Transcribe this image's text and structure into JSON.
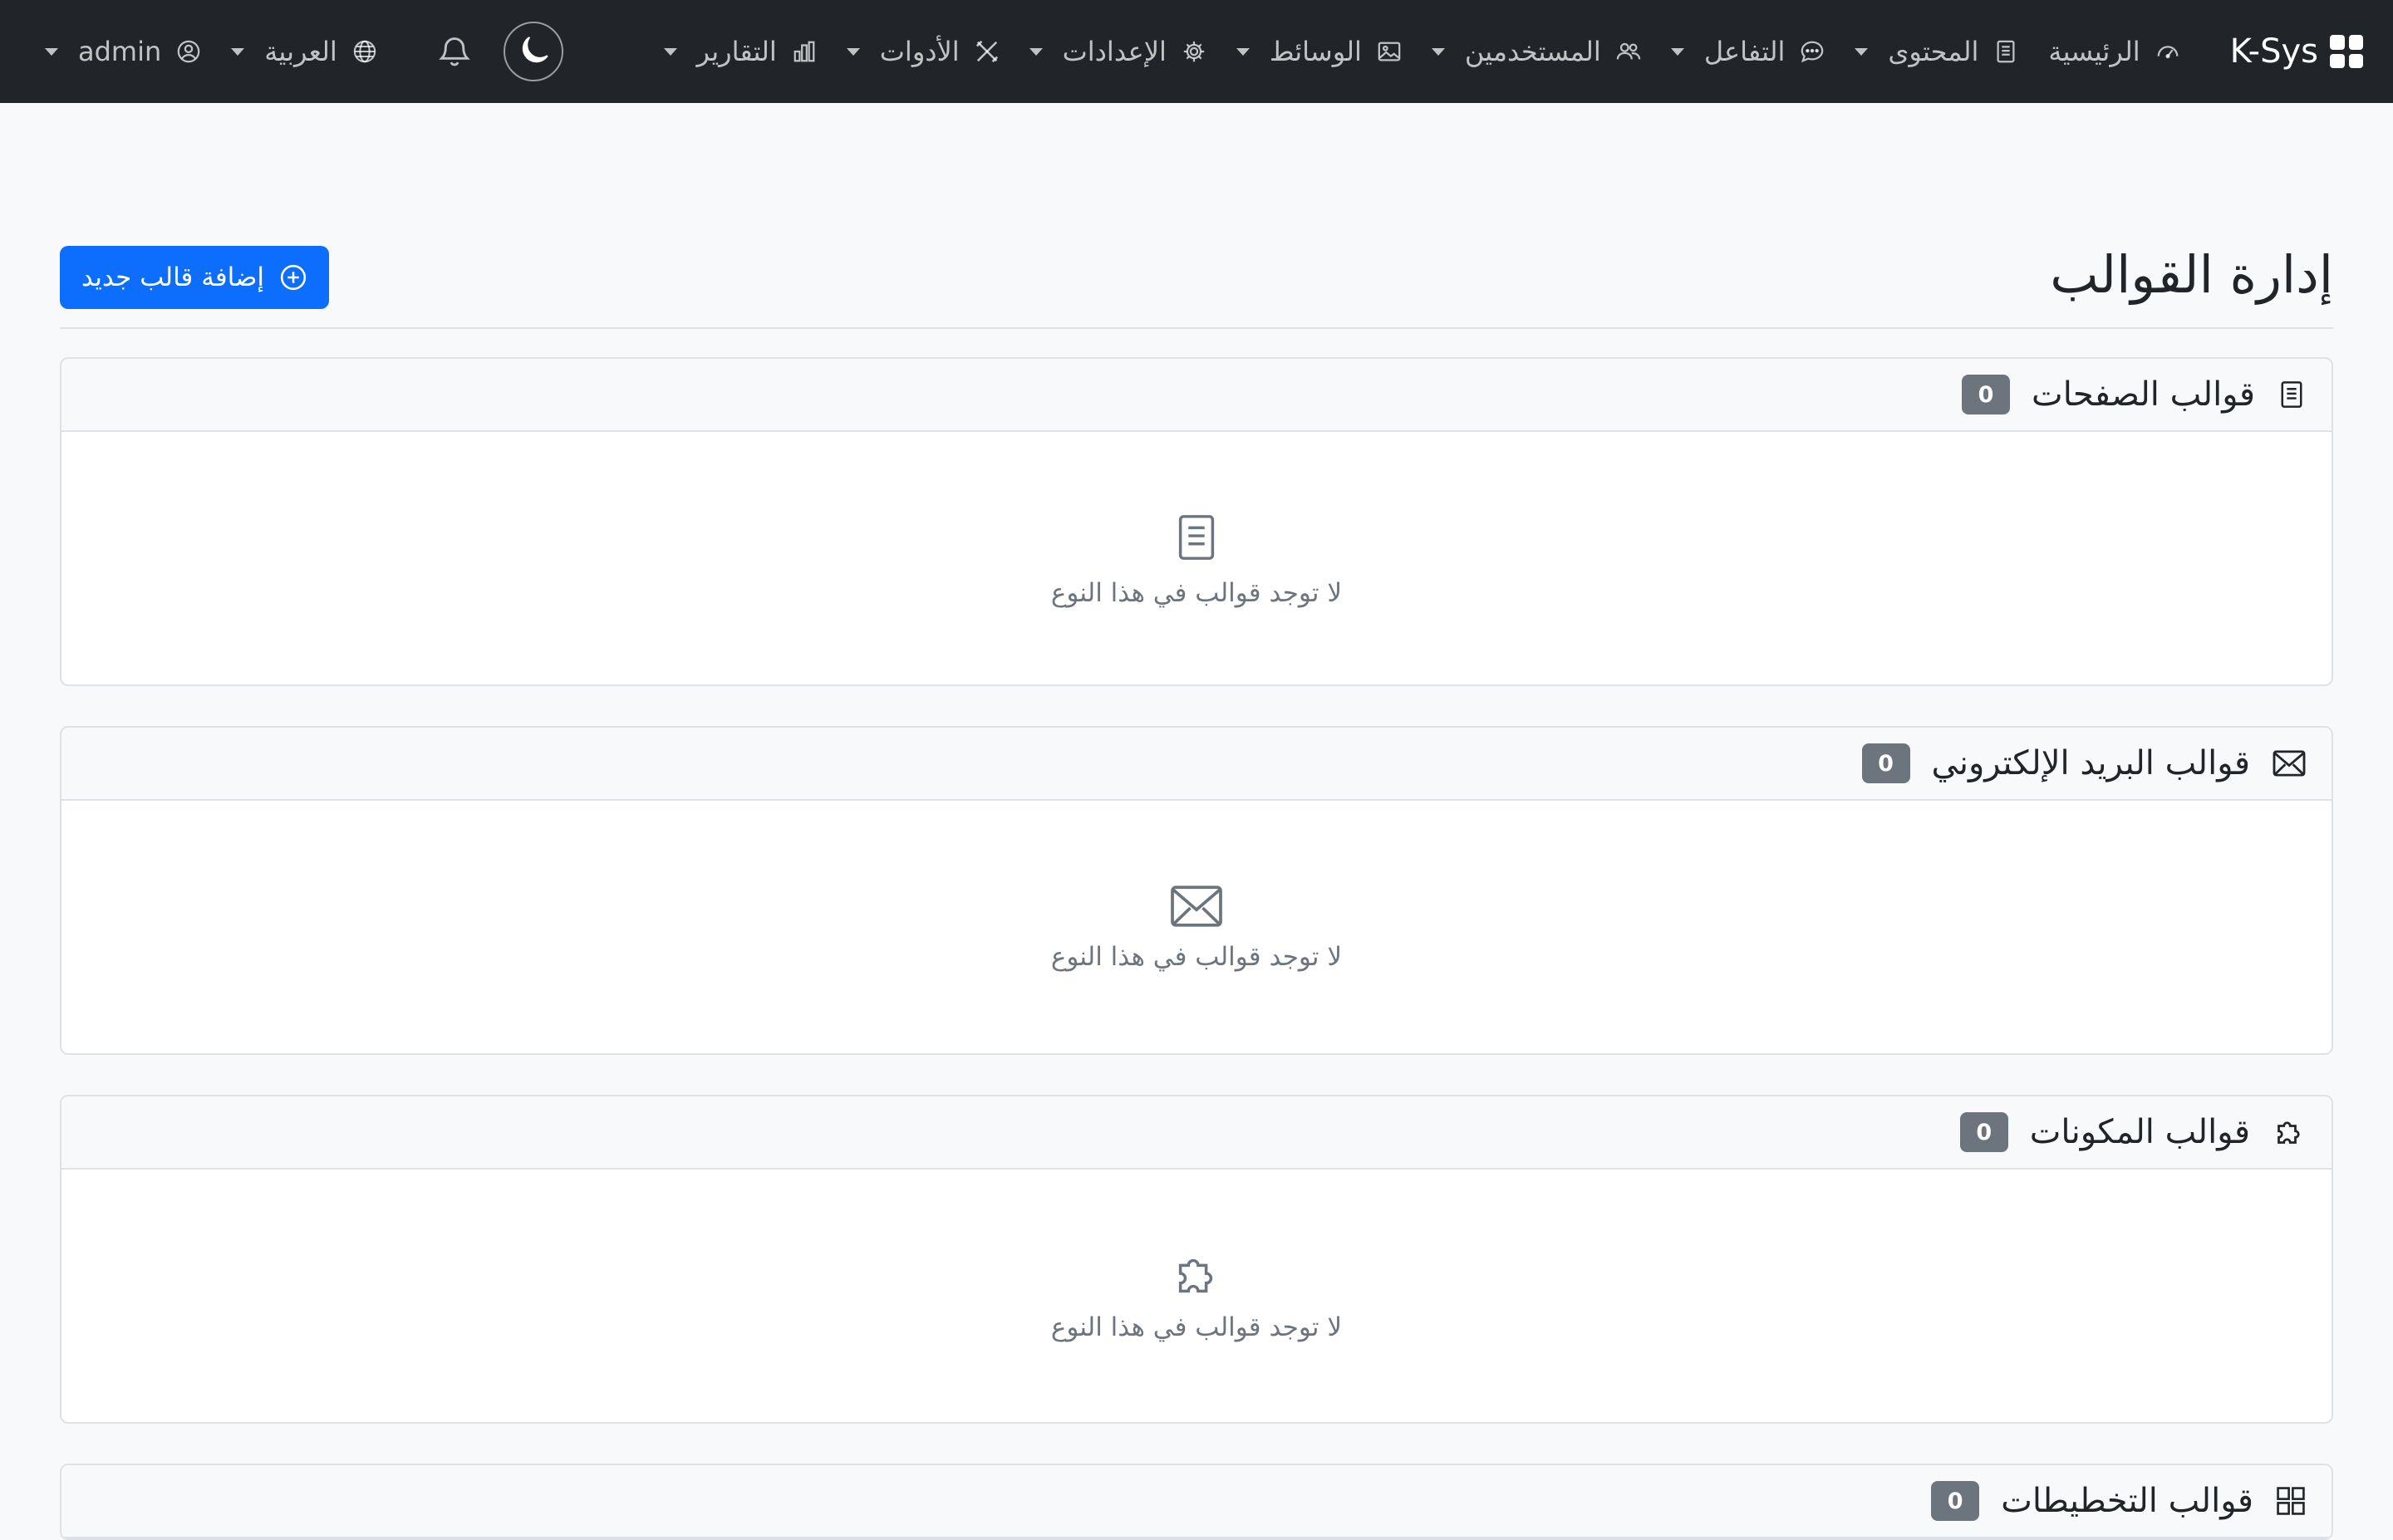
{
  "nav": {
    "brand": "K-Sys",
    "items": [
      {
        "label": "الرئيسية",
        "icon": "speedometer-icon",
        "dropdown": false
      },
      {
        "label": "المحتوى",
        "icon": "file-text-icon",
        "dropdown": true
      },
      {
        "label": "التفاعل",
        "icon": "chat-icon",
        "dropdown": true
      },
      {
        "label": "المستخدمين",
        "icon": "people-icon",
        "dropdown": true
      },
      {
        "label": "الوسائط",
        "icon": "image-icon",
        "dropdown": true
      },
      {
        "label": "الإعدادات",
        "icon": "gear-icon",
        "dropdown": true
      },
      {
        "label": "الأدوات",
        "icon": "tools-icon",
        "dropdown": true
      },
      {
        "label": "التقارير",
        "icon": "bar-chart-icon",
        "dropdown": true
      }
    ],
    "language": "العربية",
    "user": "admin"
  },
  "page": {
    "title": "إدارة القوالب",
    "add_button": "إضافة قالب جديد"
  },
  "sections": [
    {
      "title": "قوالب الصفحات",
      "count": "0",
      "icon": "file-text-icon",
      "empty_text": "لا توجد قوالب في هذا النوع"
    },
    {
      "title": "قوالب البريد الإلكتروني",
      "count": "0",
      "icon": "envelope-icon",
      "empty_text": "لا توجد قوالب في هذا النوع"
    },
    {
      "title": "قوالب المكونات",
      "count": "0",
      "icon": "puzzle-icon",
      "empty_text": "لا توجد قوالب في هذا النوع"
    },
    {
      "title": "قوالب التخطيطات",
      "count": "0",
      "icon": "grid-icon",
      "empty_text": ""
    }
  ],
  "colors": {
    "navbar": "#212529",
    "primary": "#0d6efd",
    "badge": "#6c757d",
    "background": "#f8f9fa"
  }
}
